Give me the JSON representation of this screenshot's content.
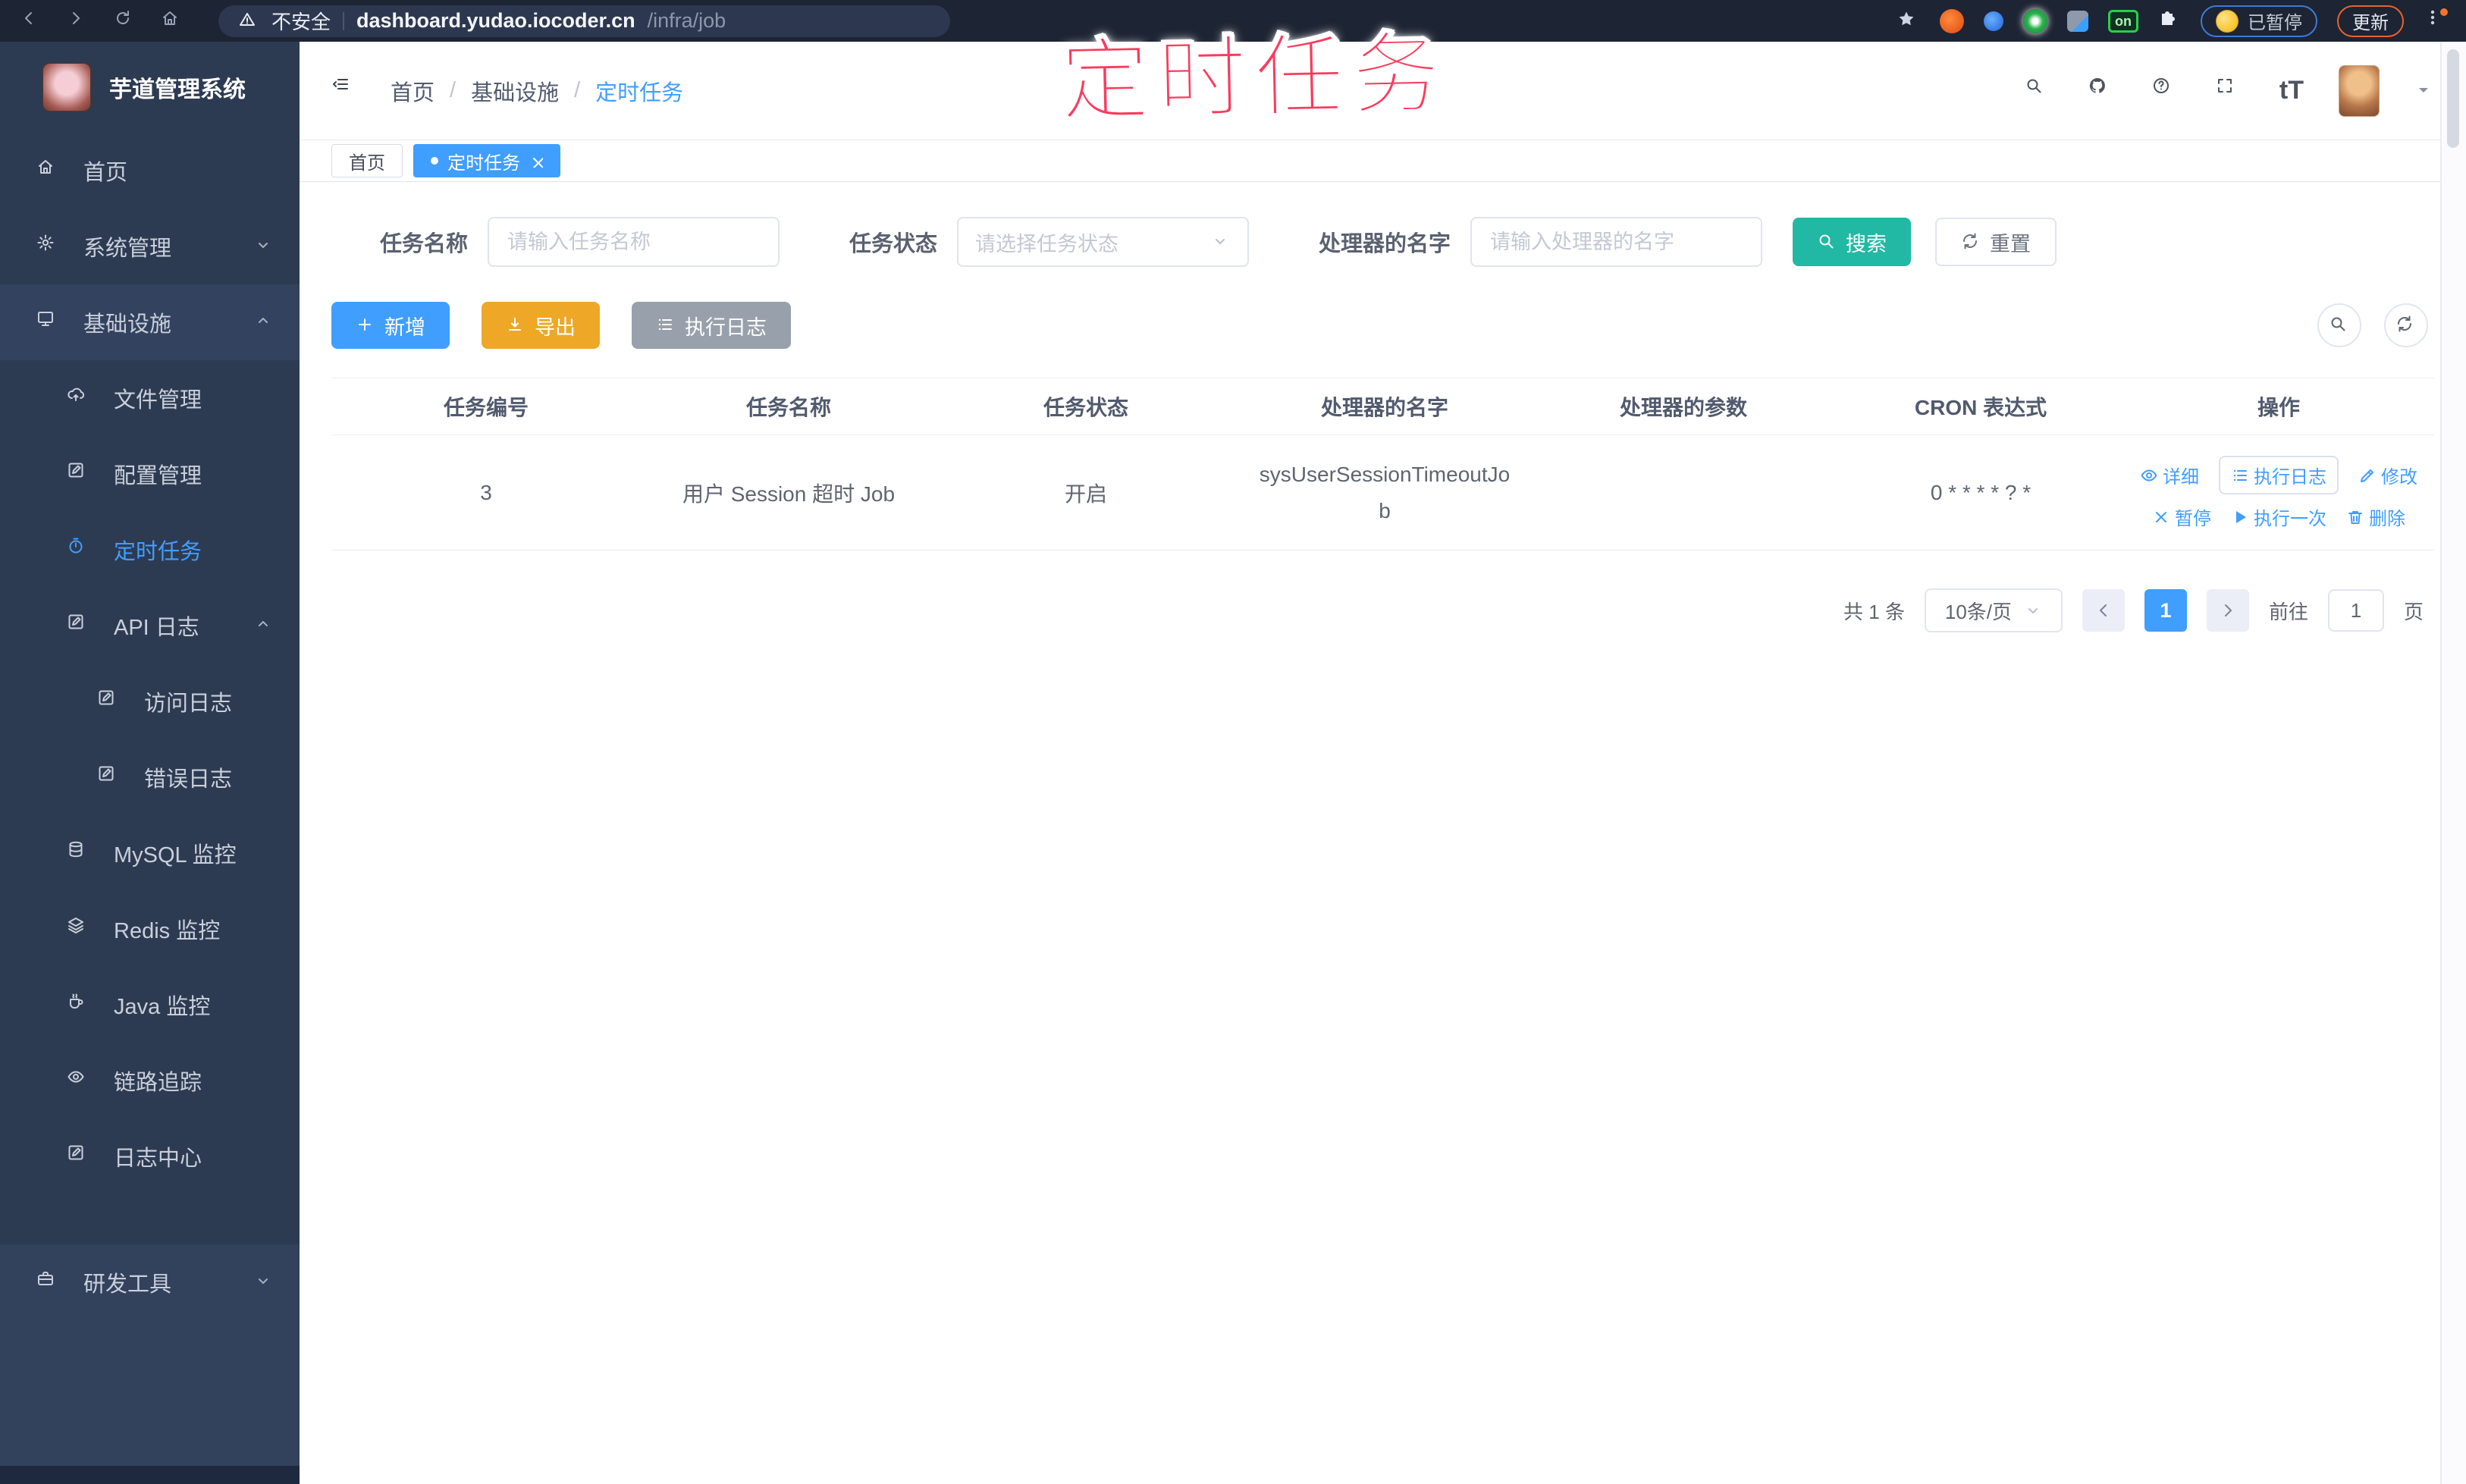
{
  "colors": {
    "accent": "#409eff",
    "search_button": "#21b9a4",
    "export_button": "#efa727",
    "info_button": "#98a0ab",
    "watermark": "#fb3b5e",
    "sidebar_bg": "#2d3b52"
  },
  "watermark": "定时任务",
  "browser": {
    "security_label": "不安全",
    "url_host": "dashboard.yudao.iocoder.cn",
    "url_path": "/infra/job",
    "extension_badge": "on",
    "paused_badge": "已暂停",
    "update_button": "更新"
  },
  "sidebar": {
    "app_title": "芋道管理系统",
    "items": [
      {
        "label": "首页"
      },
      {
        "label": "系统管理"
      },
      {
        "label": "基础设施"
      },
      {
        "label": "文件管理"
      },
      {
        "label": "配置管理"
      },
      {
        "label": "定时任务"
      },
      {
        "label": "API 日志"
      },
      {
        "label": "访问日志"
      },
      {
        "label": "错误日志"
      },
      {
        "label": "MySQL 监控"
      },
      {
        "label": "Redis 监控"
      },
      {
        "label": "Java 监控"
      },
      {
        "label": "链路追踪"
      },
      {
        "label": "日志中心"
      },
      {
        "label": "研发工具"
      }
    ]
  },
  "breadcrumb": {
    "home": "首页",
    "separator": "/",
    "section": "基础设施",
    "current": "定时任务"
  },
  "tabs": {
    "home": "首页",
    "active": "定时任务"
  },
  "filters": {
    "name_label": "任务名称",
    "name_placeholder": "请输入任务名称",
    "status_label": "任务状态",
    "status_placeholder": "请选择任务状态",
    "handler_label": "处理器的名字",
    "handler_placeholder": "请输入处理器的名字",
    "search_label": "搜索",
    "reset_label": "重置"
  },
  "toolbar": {
    "add_label": "新增",
    "export_label": "导出",
    "exec_log_label": "执行日志"
  },
  "table": {
    "headers": [
      "任务编号",
      "任务名称",
      "任务状态",
      "处理器的名字",
      "处理器的参数",
      "CRON 表达式",
      "操作"
    ],
    "rows": [
      {
        "id": "3",
        "name": "用户 Session 超时 Job",
        "status": "开启",
        "handler": "sysUserSessionTimeoutJob",
        "param": "",
        "cron": "0 * * * * ? *",
        "actions": {
          "detail": "详细",
          "exec_log": "执行日志",
          "edit": "修改",
          "pause": "暂停",
          "run_once": "执行一次",
          "delete": "删除"
        }
      }
    ]
  },
  "pagination": {
    "total": "共 1 条",
    "page_size": "10条/页",
    "page": "1",
    "goto_label": "前往",
    "goto_value": "1",
    "unit_label": "页"
  }
}
